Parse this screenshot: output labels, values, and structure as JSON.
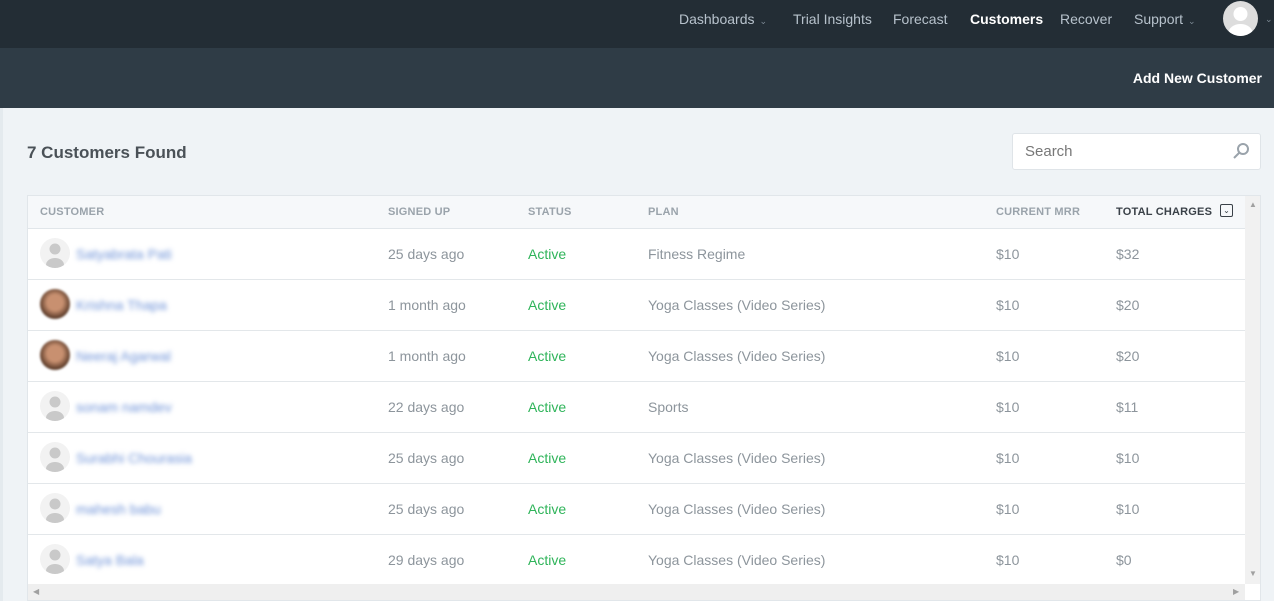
{
  "nav": {
    "items": [
      {
        "label": "Dashboards",
        "dropdown": true
      },
      {
        "label": "Trial Insights",
        "dropdown": false
      },
      {
        "label": "Forecast",
        "dropdown": false
      },
      {
        "label": "Customers",
        "dropdown": false,
        "active": true
      },
      {
        "label": "Recover",
        "dropdown": false
      },
      {
        "label": "Support",
        "dropdown": true
      }
    ]
  },
  "subbar": {
    "add_label": "Add New Customer"
  },
  "heading": "7 Customers Found",
  "search": {
    "placeholder": "Search",
    "value": ""
  },
  "table": {
    "columns": [
      "CUSTOMER",
      "SIGNED UP",
      "STATUS",
      "PLAN",
      "CURRENT MRR",
      "TOTAL CHARGES"
    ],
    "sorted_column": "TOTAL CHARGES",
    "rows": [
      {
        "name": "Satyabrata Pati",
        "avatar": "default",
        "signed_up": "25 days ago",
        "status": "Active",
        "plan": "Fitness Regime",
        "mrr": "$10",
        "total": "$32"
      },
      {
        "name": "Krishna Thapa",
        "avatar": "photo",
        "signed_up": "1 month ago",
        "status": "Active",
        "plan": "Yoga Classes (Video Series)",
        "mrr": "$10",
        "total": "$20"
      },
      {
        "name": "Neeraj Agarwal",
        "avatar": "photo",
        "signed_up": "1 month ago",
        "status": "Active",
        "plan": "Yoga Classes (Video Series)",
        "mrr": "$10",
        "total": "$20"
      },
      {
        "name": "sonam namdev",
        "avatar": "default",
        "signed_up": "22 days ago",
        "status": "Active",
        "plan": "Sports",
        "mrr": "$10",
        "total": "$11"
      },
      {
        "name": "Surabhi Chourasia",
        "avatar": "default",
        "signed_up": "25 days ago",
        "status": "Active",
        "plan": "Yoga Classes (Video Series)",
        "mrr": "$10",
        "total": "$10"
      },
      {
        "name": "mahesh babu",
        "avatar": "default",
        "signed_up": "25 days ago",
        "status": "Active",
        "plan": "Yoga Classes (Video Series)",
        "mrr": "$10",
        "total": "$10"
      },
      {
        "name": "Satya Bala",
        "avatar": "default",
        "signed_up": "29 days ago",
        "status": "Active",
        "plan": "Yoga Classes (Video Series)",
        "mrr": "$10",
        "total": "$0"
      }
    ]
  },
  "colors": {
    "nav_bg": "#232d35",
    "subbar_bg": "#2f3c46",
    "status_active": "#2fb45a",
    "link": "#6f93d8"
  }
}
